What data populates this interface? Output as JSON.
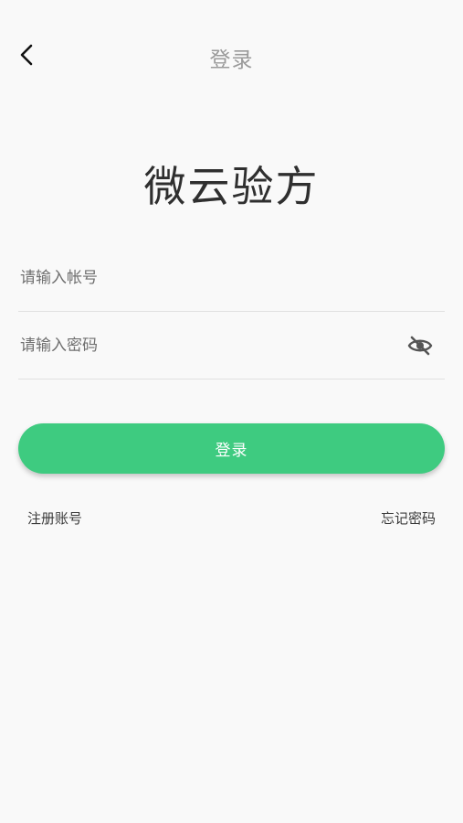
{
  "nav": {
    "title": "登录"
  },
  "app": {
    "title": "微云验方"
  },
  "form": {
    "account_placeholder": "请输入帐号",
    "account_value": "",
    "password_placeholder": "请输入密码",
    "password_value": "",
    "password_toggle_icon": "eye-off-icon",
    "login_label": "登录"
  },
  "links": {
    "register": "注册账号",
    "forgot": "忘记密码"
  },
  "colors": {
    "accent": "#3ecb80",
    "background": "#f9f9f9",
    "nav_title": "#9a9a9a"
  }
}
